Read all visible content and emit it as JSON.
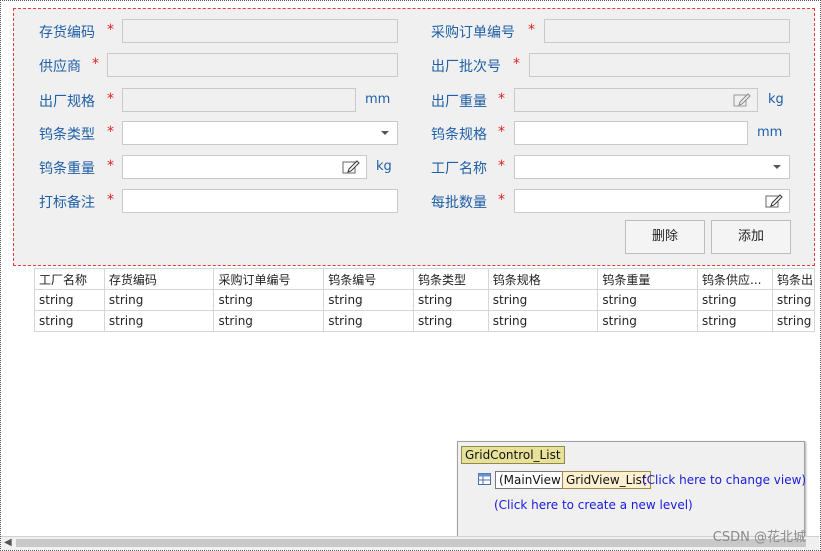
{
  "form": {
    "left": [
      {
        "label": "存货编码",
        "required": "*"
      },
      {
        "label": "供应商",
        "required": "*"
      },
      {
        "label": "出厂规格",
        "required": "*",
        "unit": "mm"
      },
      {
        "label": "钨条类型",
        "required": "*"
      },
      {
        "label": "钨条重量",
        "required": "*",
        "unit": "kg"
      },
      {
        "label": "打标备注",
        "required": "*"
      }
    ],
    "right": [
      {
        "label": "采购订单编号",
        "required": "*"
      },
      {
        "label": "出厂批次号",
        "required": "*"
      },
      {
        "label": "出厂重量",
        "required": "*",
        "unit": "kg"
      },
      {
        "label": "钨条规格",
        "required": "*",
        "unit": "mm"
      },
      {
        "label": "工厂名称",
        "required": "*"
      },
      {
        "label": "每批数量",
        "required": "*"
      }
    ],
    "buttons": {
      "delete": "删除",
      "add": "添加"
    }
  },
  "grid": {
    "columns": [
      "工厂名称",
      "存货编码",
      "采购订单编号",
      "钨条编号",
      "钨条类型",
      "钨条规格",
      "钨条重量",
      "钨条供应...",
      "钨条出"
    ],
    "rows": [
      [
        "string",
        "string",
        "string",
        "string",
        "string",
        "string",
        "string",
        "string",
        "string"
      ],
      [
        "string",
        "string",
        "string",
        "string",
        "string",
        "string",
        "string",
        "string",
        "string"
      ]
    ]
  },
  "designer": {
    "control": "GridControl_List",
    "main_view": "(MainView)",
    "view_name": "GridView_List",
    "change_view": "(Click here to change view)",
    "new_level": "(Click here to create a new level)"
  },
  "watermark": "CSDN @花北城",
  "colors": {
    "label": "#1f5fa6",
    "required": "#e02020",
    "tag": "#e7e19a",
    "link": "#1a1adb"
  }
}
